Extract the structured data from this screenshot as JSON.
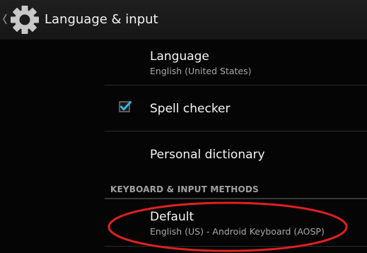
{
  "action_bar": {
    "title": "Language & input",
    "app_icon": "settings-gear-icon",
    "up_icon": "chevron-left-icon"
  },
  "preferences": {
    "language": {
      "title": "Language",
      "summary": "English (United States)"
    },
    "spell_checker": {
      "title": "Spell checker",
      "checked": true,
      "checkbox_color": "#33b5e5"
    },
    "personal_dictionary": {
      "title": "Personal dictionary"
    }
  },
  "keyboard_section": {
    "header": "KEYBOARD & INPUT METHODS",
    "default": {
      "title": "Default",
      "summary": "English (US) - Android Keyboard (AOSP)"
    }
  },
  "annotation": {
    "shape": "ellipse",
    "color": "#e02020",
    "target": "default"
  }
}
